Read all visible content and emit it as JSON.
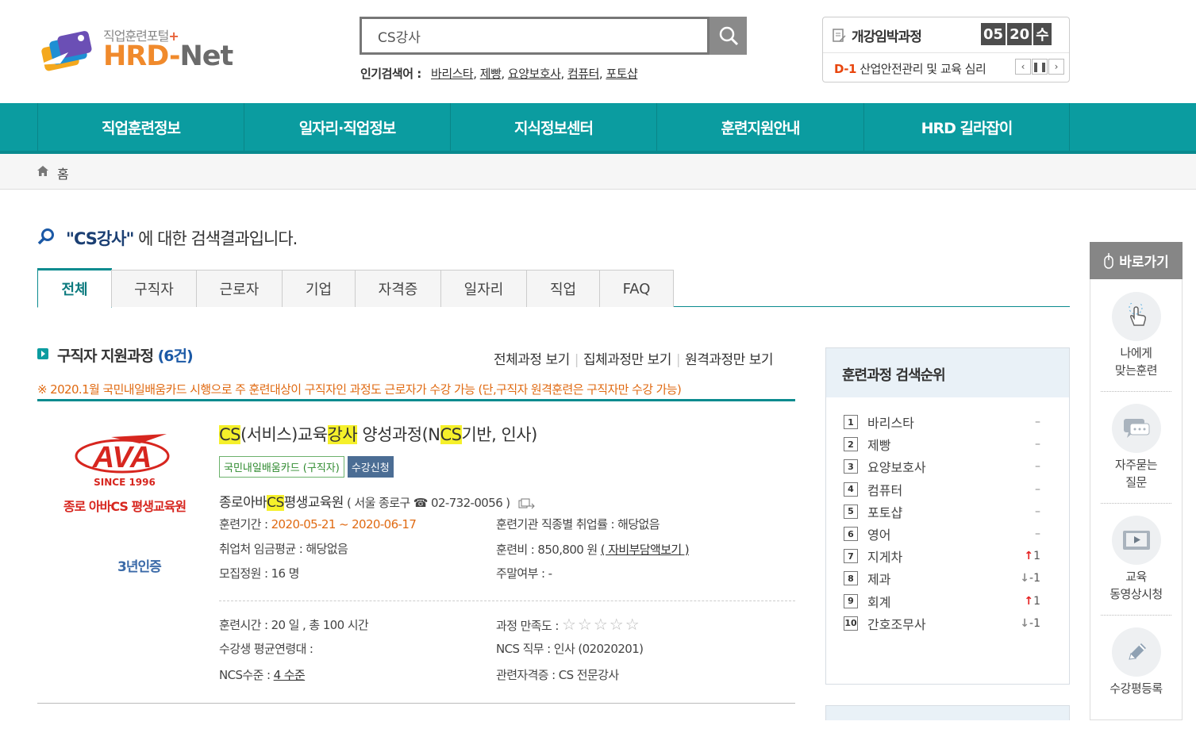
{
  "header": {
    "logo_sub": "직업훈련포털",
    "logo_plus": "+",
    "logo_hrd": "HRD-",
    "logo_net": "Net",
    "search_value": "CS강사",
    "popular_label": "인기검색어 :",
    "popular": [
      "바리스타",
      "제빵",
      "요양보호사",
      "컴퓨터",
      "포토샵"
    ],
    "upcoming": {
      "title": "개강임박과정",
      "month": "05",
      "day": "20",
      "weekday": "수",
      "dday": "D-1",
      "course": "산업안전관리 및 교육 심리"
    }
  },
  "gnb": [
    "직업훈련정보",
    "일자리·직업정보",
    "지식정보센터",
    "훈련지원안내",
    "HRD 길라잡이"
  ],
  "breadcrumb": {
    "home": "홈"
  },
  "result": {
    "query": "\"CS강사\"",
    "suffix": " 에 대한 검색결과입니다."
  },
  "tabs": [
    "전체",
    "구직자",
    "근로자",
    "기업",
    "자격증",
    "일자리",
    "직업",
    "FAQ"
  ],
  "section": {
    "title": "구직자 지원과정",
    "count": "(6건)",
    "links": [
      "전체과정 보기",
      "집체과정만 보기",
      "원격과정만 보기"
    ],
    "notice": "※ 2020.1월 국민내일배움카드 시행으로 주 훈련대상이 구직자인 과정도 근로자가 수강 가능 (단,구직자 원격훈련은 구직자만 수강 가능)"
  },
  "course": {
    "org_logo_main": "AVA",
    "org_logo_since": "SINCE 1996",
    "org_logo_name": "종로 아바CS 평생교육원",
    "cert_badge": "3년인증",
    "title_parts": [
      "CS",
      "(서비스)교육",
      "강사",
      " 양성과정(N",
      "CS",
      "기반, 인사)"
    ],
    "badge_card": "국민내일배움카드 (구직자)",
    "badge_apply": "수강신청",
    "org_pre": "종로아바",
    "org_hl": "CS",
    "org_post": "평생교육원",
    "org_loc": "( 서울 종로구 ☎ 02-732-0056 )",
    "period_label": "훈련기간 :",
    "period": "2020-05-21 ~ 2020-06-17",
    "employ_label": "훈련기관 직종별 취업률 :",
    "employ": "해당없음",
    "wage_label": "취업처 임금평균 :",
    "wage": "해당없음",
    "fee_label": "훈련비 :",
    "fee": "850,800 원",
    "fee_link": "( 자비부담액보기 )",
    "quota_label": "모집정원 :",
    "quota": "16 명",
    "weekend_label": "주말여부 :",
    "weekend": "-",
    "hours_label": "훈련시간 :",
    "hours": "20 일 , 총 100 시간",
    "satisfaction_label": "과정 만족도 :",
    "satisfaction_stars": 0,
    "age_label": "수강생 평균연령대 :",
    "age": "",
    "ncs_job_label": "NCS 직무 :",
    "ncs_job": "인사 (02020201)",
    "ncs_level_label": "NCS수준 :",
    "ncs_level": "4 수준",
    "cert_label": "관련자격증 :",
    "cert": "CS 전문강사"
  },
  "ranking": {
    "title": "훈련과정 검색순위",
    "items": [
      {
        "rank": "1",
        "name": "바리스타",
        "dir": "same",
        "change": ""
      },
      {
        "rank": "2",
        "name": "제빵",
        "dir": "same",
        "change": ""
      },
      {
        "rank": "3",
        "name": "요양보호사",
        "dir": "same",
        "change": ""
      },
      {
        "rank": "4",
        "name": "컴퓨터",
        "dir": "same",
        "change": ""
      },
      {
        "rank": "5",
        "name": "포토샵",
        "dir": "same",
        "change": ""
      },
      {
        "rank": "6",
        "name": "영어",
        "dir": "same",
        "change": ""
      },
      {
        "rank": "7",
        "name": "지게차",
        "dir": "up",
        "change": "1"
      },
      {
        "rank": "8",
        "name": "제과",
        "dir": "down",
        "change": "-1"
      },
      {
        "rank": "9",
        "name": "회계",
        "dir": "up",
        "change": "1"
      },
      {
        "rank": "10",
        "name": "간호조무사",
        "dir": "down",
        "change": "-1"
      }
    ]
  },
  "quick": {
    "title": "바로가기",
    "items": [
      {
        "line1": "나에게",
        "line2": "맞는훈련",
        "icon": "hand-pointer-icon"
      },
      {
        "line1": "자주묻는",
        "line2": "질문",
        "icon": "chat-bubble-icon"
      },
      {
        "line1": "교육",
        "line2": "동영상시청",
        "icon": "video-icon"
      },
      {
        "line1": "수강평등록",
        "line2": "",
        "icon": "pencil-icon"
      }
    ]
  },
  "colors": {
    "teal": "#0b9ca0",
    "orange": "#e06a12",
    "highlight": "#f5f02a",
    "navy": "#1b3f73"
  }
}
